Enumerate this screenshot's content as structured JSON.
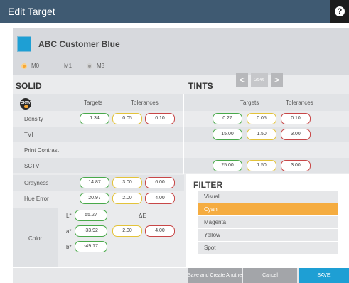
{
  "window": {
    "title": "Edit Target",
    "help_icon": "?"
  },
  "target": {
    "name": "ABC Customer Blue",
    "swatch_color": "#1e9fd4"
  },
  "measurement_modes": [
    {
      "label": "M0",
      "selected": true
    },
    {
      "label": "M1",
      "selected": false
    },
    {
      "label": "M3",
      "selected": false
    }
  ],
  "solid": {
    "title": "SOLID",
    "col_targets": "Targets",
    "col_tolerances": "Tolerances"
  },
  "tints": {
    "title": "TINTS",
    "prev": "<",
    "value": "25%",
    "next": ">",
    "col_targets": "Targets",
    "col_tolerances": "Tolerances"
  },
  "rows": {
    "density": {
      "label": "Density",
      "solid": [
        "1.34",
        "0.05",
        "0.10"
      ],
      "tints": [
        "0.27",
        "0.05",
        "0.10"
      ]
    },
    "tvi": {
      "label": "TVI",
      "tints": [
        "15.00",
        "1.50",
        "3.00"
      ]
    },
    "print_contrast": {
      "label": "Print Contrast"
    },
    "sctv": {
      "label": "SCTV",
      "tints": [
        "25.00",
        "1.50",
        "3.00"
      ]
    },
    "grayness": {
      "label": "Grayness",
      "solid": [
        "14.87",
        "3.00",
        "6.00"
      ]
    },
    "hue_error": {
      "label": "Hue Error",
      "solid": [
        "20.97",
        "2.00",
        "4.00"
      ]
    }
  },
  "color": {
    "label": "Color",
    "l_label": "L*",
    "l_value": "55.27",
    "a_label": "a*",
    "a_value": "-33.92",
    "b_label": "b*",
    "b_value": "-49.17",
    "delta_label": "ΔE",
    "tolerances": [
      "2.00",
      "4.00"
    ]
  },
  "filter": {
    "title": "FILTER",
    "items": [
      "Visual",
      "Cyan",
      "Magenta",
      "Yellow",
      "Spot"
    ],
    "selected": "Cyan"
  },
  "footer": {
    "save_and_create": "Save and Create Another",
    "cancel": "Cancel",
    "save": "SAVE"
  },
  "colors": {
    "accent": "#1e9fd4",
    "titlebar": "#3f5a72",
    "selection": "#f5ac40",
    "target_border": "#49a94a",
    "warning_border": "#e3c33a",
    "error_border": "#c84747"
  }
}
